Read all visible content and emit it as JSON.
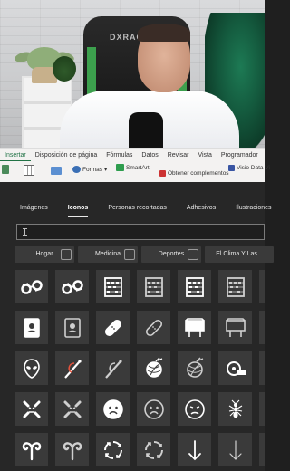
{
  "webcam": {
    "chair_brand": "DXRACER"
  },
  "ribbon": {
    "tabs": [
      "Insertar",
      "Disposición de página",
      "Fórmulas",
      "Datos",
      "Revisar",
      "Vista",
      "Programador"
    ],
    "active_tab": "Insertar",
    "commands": {
      "formas": "Formas",
      "smartart": "SmartArt",
      "obtener_complementos": "Obtener complementos",
      "visio": "Visio Data Vi"
    }
  },
  "dialog": {
    "tabs": [
      "Imágenes",
      "Iconos",
      "Personas recortadas",
      "Adhesivos",
      "Ilustraciones"
    ],
    "active_tab": "Iconos",
    "search": {
      "value": "",
      "placeholder": ""
    },
    "categories": [
      "Hogar",
      "Medicina",
      "Deportes",
      "El Clima Y Las..."
    ],
    "icon_rows": [
      [
        "handcuffs-icon",
        "handcuffs-open-icon",
        "abacus-icon",
        "abacus-alt-icon",
        "abacus-frame-icon",
        "abacus-frame-alt-icon",
        "abacus-extra-icon"
      ],
      [
        "address-book-icon",
        "address-book-outline-icon",
        "bandage-icon",
        "bandage-outline-icon",
        "billboard-icon",
        "billboard-outline-icon",
        "billboard-extra-icon"
      ],
      [
        "alien-icon",
        "knitting-needle-icon",
        "knitting-needle-outline-icon",
        "yarn-ball-icon",
        "yarn-ball-outline-icon",
        "measuring-tape-icon",
        "extra-icon"
      ],
      [
        "angry-face-icon",
        "angry-face-outline-icon",
        "sad-face-icon",
        "sad-face-outline-icon",
        "frown-face-icon",
        "ant-icon",
        "ant-outline-icon"
      ],
      [
        "aries-icon",
        "aries-outline-icon",
        "arrows-circle-icon",
        "arrows-circle-outline-icon",
        "arrow-down-icon",
        "arrow-down-outline-icon",
        "arrow-extra-icon"
      ]
    ]
  }
}
